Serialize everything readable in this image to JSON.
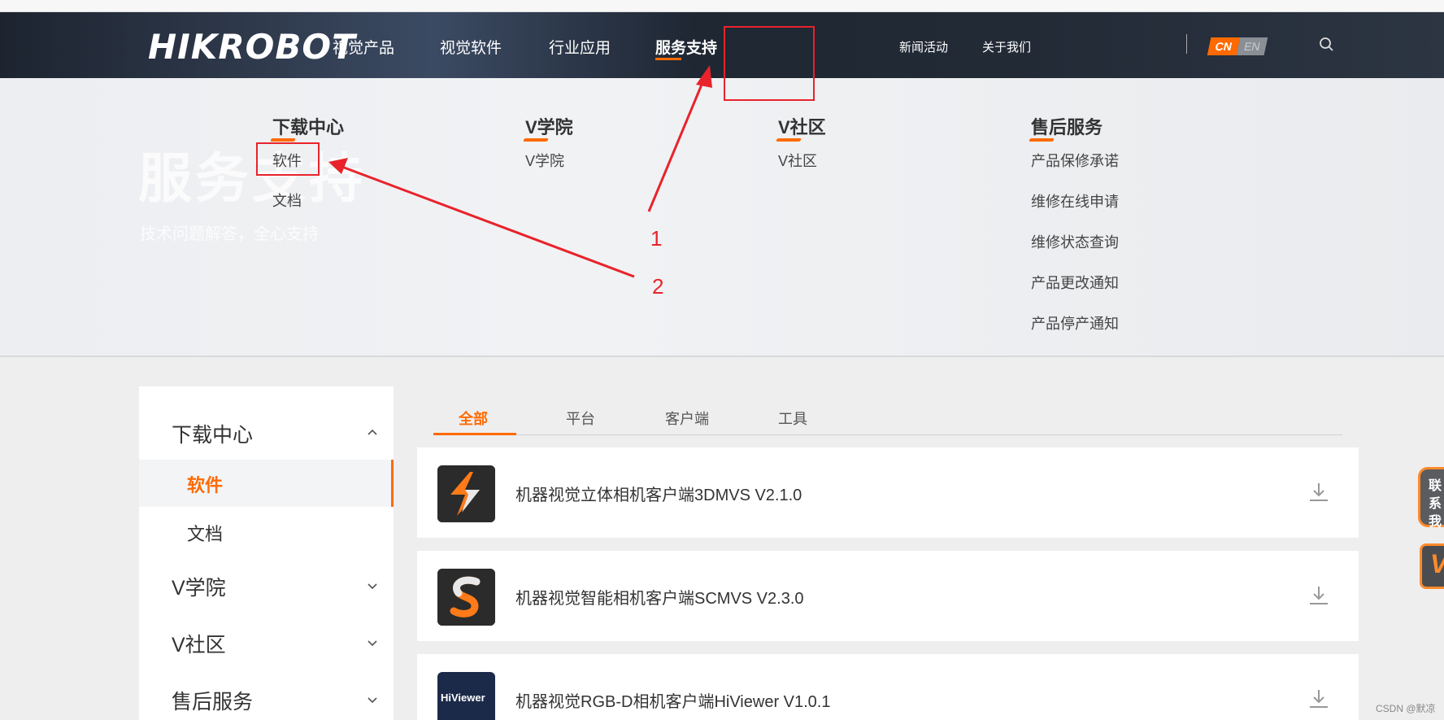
{
  "navbar": {
    "logo": "HIKROBOT",
    "items": [
      "视觉产品",
      "视觉软件",
      "行业应用",
      "服务支持"
    ],
    "right_items": [
      "新闻活动",
      "关于我们"
    ],
    "lang_cn": "CN",
    "lang_en": "EN",
    "search_icon": "search-icon"
  },
  "hero": {
    "title": "服务支持",
    "subtitle": "技术问题解答，全心支持"
  },
  "menu": {
    "columns": [
      {
        "heading": "下载中心",
        "links": [
          "软件",
          "文档"
        ]
      },
      {
        "heading": "V学院",
        "links": [
          "V学院"
        ]
      },
      {
        "heading": "V社区",
        "links": [
          "V社区"
        ]
      },
      {
        "heading": "售后服务",
        "links": [
          "产品保修承诺",
          "维修在线申请",
          "维修状态查询",
          "产品更改通知",
          "产品停产通知"
        ]
      }
    ]
  },
  "annotations": {
    "label1": "1",
    "label2": "2",
    "color": "#e8232b"
  },
  "sidebar": {
    "groups": [
      {
        "label": "下载中心",
        "expanded": true,
        "sub": [
          "软件",
          "文档"
        ]
      },
      {
        "label": "V学院",
        "expanded": false
      },
      {
        "label": "V社区",
        "expanded": false
      },
      {
        "label": "售后服务",
        "expanded": false
      }
    ]
  },
  "tabs": [
    "全部",
    "平台",
    "客户端",
    "工具"
  ],
  "products": [
    {
      "title": "机器视觉立体相机客户端3DMVS V2.1.0"
    },
    {
      "title": "机器视觉智能相机客户端SCMVS V2.3.0"
    },
    {
      "title": "机器视觉RGB-D相机客户端HiViewer V1.0.1",
      "icon_text": "HiViewer"
    }
  ],
  "float": {
    "contact_label": "联系我",
    "v_label": "V"
  },
  "watermark": "CSDN @默凉",
  "colors": {
    "accent": "#ff6a00",
    "annotation": "#e8232b"
  }
}
